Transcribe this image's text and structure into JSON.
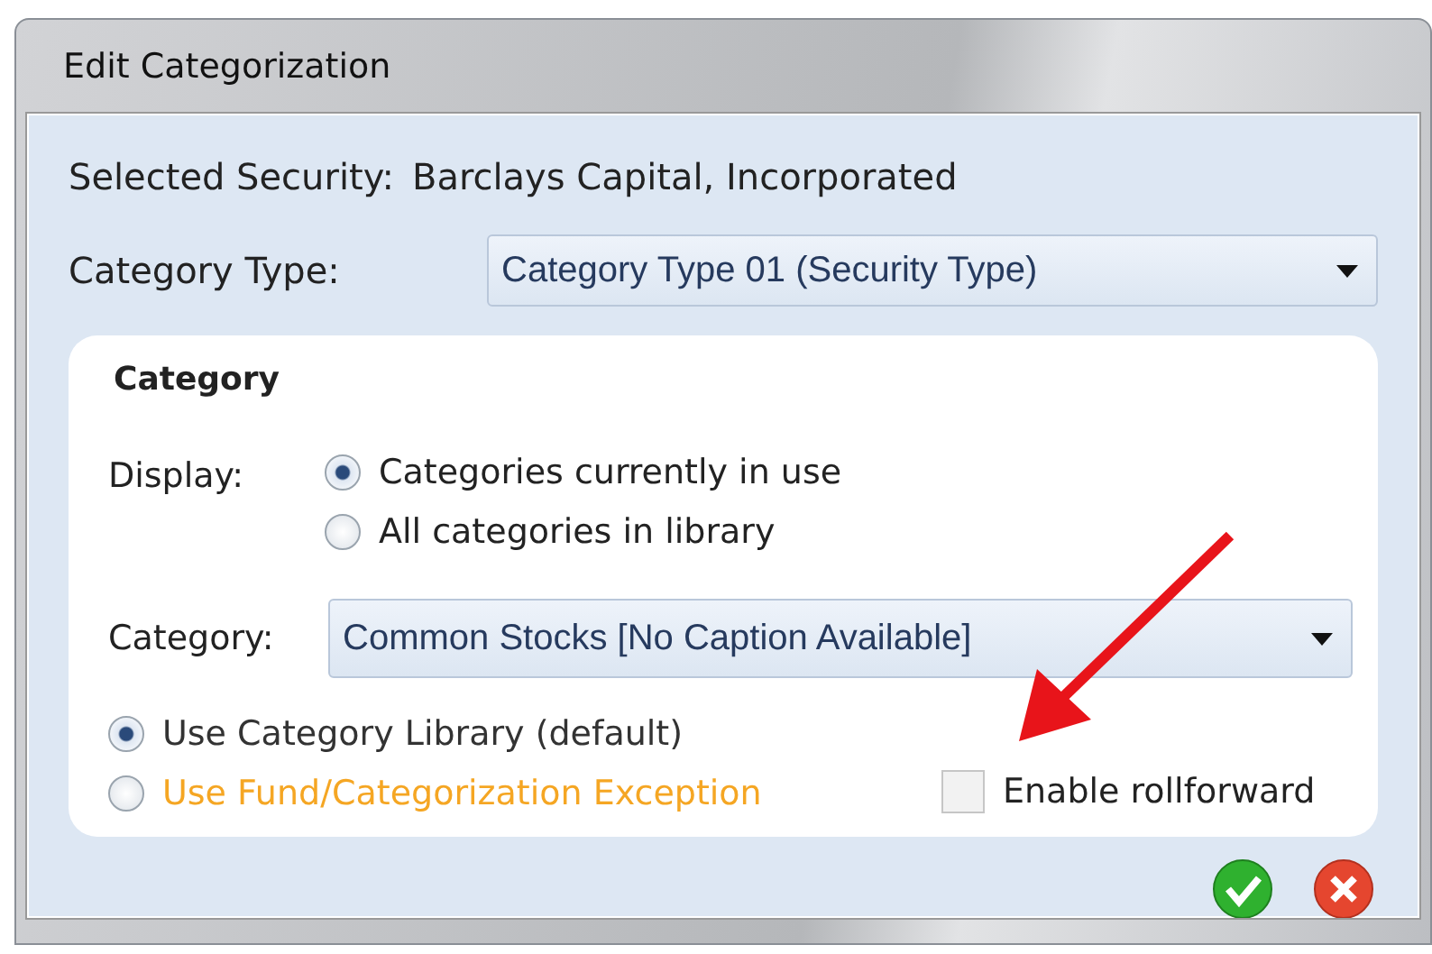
{
  "window": {
    "title": "Edit Categorization"
  },
  "selected_security": {
    "label": "Selected Security:",
    "value": "Barclays Capital, Incorporated"
  },
  "category_type": {
    "label": "Category Type:",
    "value": "Category Type 01 (Security Type)"
  },
  "category_panel": {
    "title": "Category",
    "display": {
      "label": "Display:",
      "options": [
        {
          "label": "Categories currently in use",
          "selected": true
        },
        {
          "label": "All categories in library",
          "selected": false
        }
      ]
    },
    "category": {
      "label": "Category:",
      "value": "Common Stocks [No Caption Available]"
    },
    "source_options": [
      {
        "label": "Use Category Library (default)",
        "selected": true,
        "color": "#333333"
      },
      {
        "label": "Use Fund/Categorization Exception",
        "selected": false,
        "color": "#f5a623"
      }
    ],
    "rollforward": {
      "label": "Enable rollforward",
      "checked": false
    }
  },
  "buttons": [
    {
      "kind": "ok"
    },
    {
      "kind": "cancel"
    }
  ]
}
